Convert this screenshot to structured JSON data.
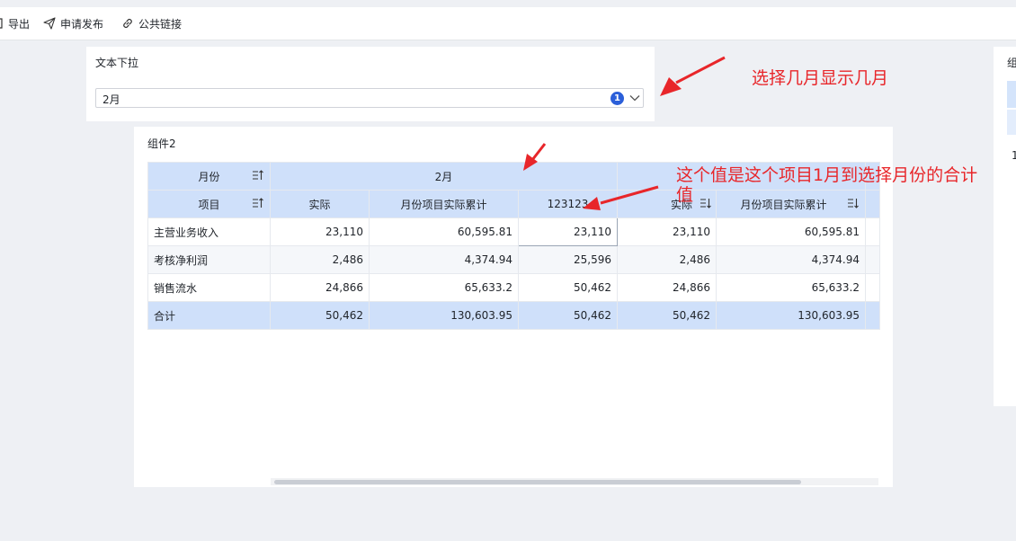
{
  "toolbar": {
    "items": [
      {
        "label": "导出",
        "icon": "export-icon"
      },
      {
        "label": "申请发布",
        "icon": "send-icon"
      },
      {
        "label": "公共链接",
        "icon": "link-icon"
      }
    ]
  },
  "filter": {
    "title": "文本下拉",
    "selected_value": "2月",
    "selected_count": "1"
  },
  "right_widget": {
    "title": "组",
    "cell": "1"
  },
  "widget": {
    "title": "组件2",
    "header": {
      "row1": {
        "dim_label": "月份",
        "group_label": "2月"
      },
      "row2": {
        "dim_label": "项目",
        "columns": [
          "实际",
          "月份项目实际累计",
          "123123",
          "实际",
          "月份项目实际累计"
        ]
      }
    },
    "rows": [
      {
        "name": "主营业务收入",
        "values": [
          "23,110",
          "60,595.81",
          "23,110",
          "23,110",
          "60,595.81"
        ]
      },
      {
        "name": "考核净利润",
        "values": [
          "2,486",
          "4,374.94",
          "25,596",
          "2,486",
          "4,374.94"
        ]
      },
      {
        "name": "销售流水",
        "values": [
          "24,866",
          "65,633.2",
          "50,462",
          "24,866",
          "65,633.2"
        ]
      },
      {
        "name": "合计",
        "values": [
          "50,462",
          "130,603.95",
          "50,462",
          "50,462",
          "130,603.95"
        ]
      }
    ]
  },
  "annotations": {
    "month_note": "选择几月显示几月",
    "sum_note_line1": "这个值是这个项目1月到选择月份的合计",
    "sum_note_line2": "值"
  },
  "colors": {
    "header_bg": "#cfe0fa",
    "accent": "#2b5fd9",
    "annotation": "#e8262a"
  }
}
